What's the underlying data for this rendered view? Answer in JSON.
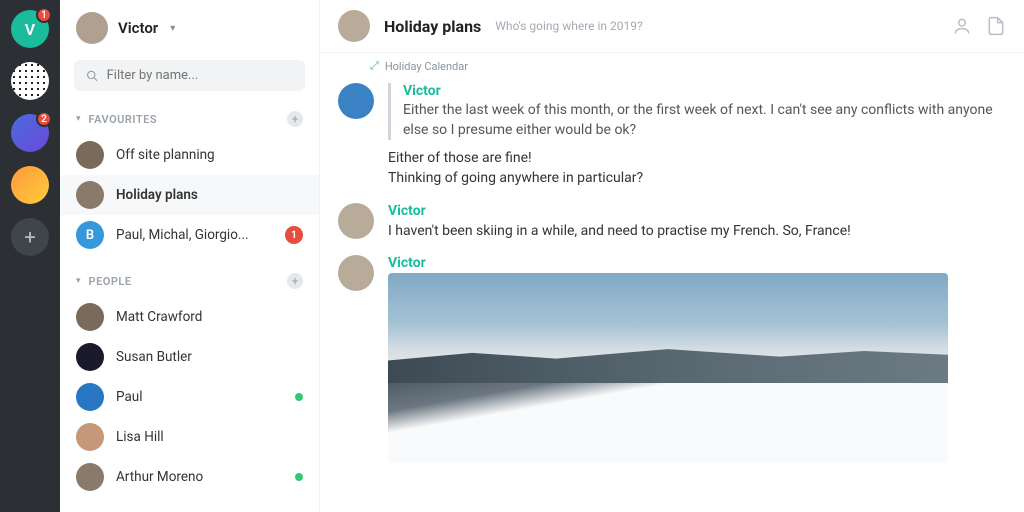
{
  "rail": {
    "items": [
      {
        "letter": "V",
        "badge": "1",
        "cls": "v"
      },
      {
        "cls": "dot"
      },
      {
        "badge": "2",
        "cls": "swirl"
      },
      {
        "cls": "flame"
      }
    ]
  },
  "sidebar": {
    "user_name": "Victor",
    "filter_placeholder": "Filter by name...",
    "sections": {
      "favourites_title": "FAVOURITES",
      "people_title": "PEOPLE"
    },
    "favourites": [
      {
        "label": "Off site planning",
        "cls": "p1"
      },
      {
        "label": "Holiday plans",
        "active": true,
        "cls": "p5"
      },
      {
        "label": "Paul, Michal, Giorgio...",
        "badge": "1",
        "letter": "B",
        "cls": "b"
      }
    ],
    "people": [
      {
        "label": "Matt Crawford",
        "cls": "p1"
      },
      {
        "label": "Susan Butler",
        "cls": "p2"
      },
      {
        "label": "Paul",
        "online": true,
        "cls": "p3"
      },
      {
        "label": "Lisa Hill",
        "cls": "p4"
      },
      {
        "label": "Arthur Moreno",
        "online": true,
        "cls": "p5"
      }
    ]
  },
  "chat": {
    "title": "Holiday plans",
    "subtitle": "Who's going where in 2019?",
    "attachment_label": "Holiday Calendar",
    "messages": [
      {
        "quote_author": "Victor",
        "quote_text": "Either the last week of this month, or the first week of next. I can't see any conflicts with anyone else so I presume either would be ok?",
        "text_line1": "Either of those are fine!",
        "text_line2": "Thinking of going anywhere in particular?",
        "av": "blue"
      },
      {
        "author": "Victor",
        "text": "I haven't been skiing in a while, and need to practise my French. So, France!"
      },
      {
        "author": "Victor",
        "image": true
      }
    ]
  }
}
